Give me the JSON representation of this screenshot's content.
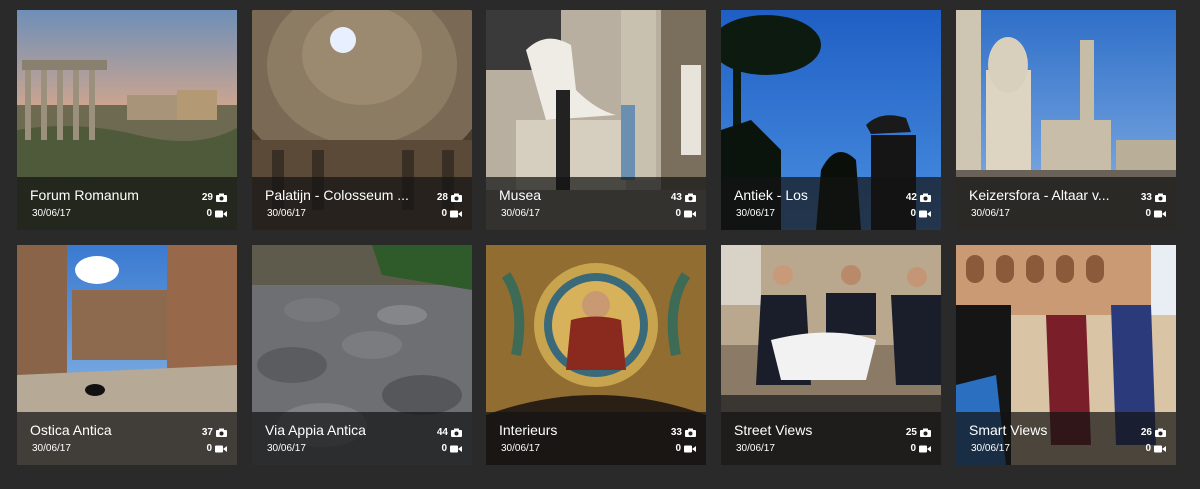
{
  "albums": [
    {
      "title": "Forum Romanum",
      "date": "30/06/17",
      "photos": "29",
      "videos": "0"
    },
    {
      "title": "Palatijn - Colosseum ...",
      "date": "30/06/17",
      "photos": "28",
      "videos": "0"
    },
    {
      "title": "Musea",
      "date": "30/06/17",
      "photos": "43",
      "videos": "0"
    },
    {
      "title": "Antiek - Los",
      "date": "30/06/17",
      "photos": "42",
      "videos": "0"
    },
    {
      "title": "Keizersfora - Altaar v...",
      "date": "30/06/17",
      "photos": "33",
      "videos": "0"
    },
    {
      "title": "Ostica Antica",
      "date": "30/06/17",
      "photos": "37",
      "videos": "0"
    },
    {
      "title": "Via Appia Antica",
      "date": "30/06/17",
      "photos": "44",
      "videos": "0"
    },
    {
      "title": "Interieurs",
      "date": "30/06/17",
      "photos": "33",
      "videos": "0"
    },
    {
      "title": "Street Views",
      "date": "30/06/17",
      "photos": "25",
      "videos": "0"
    },
    {
      "title": "Smart Views",
      "date": "30/06/17",
      "photos": "26",
      "videos": "0"
    }
  ]
}
